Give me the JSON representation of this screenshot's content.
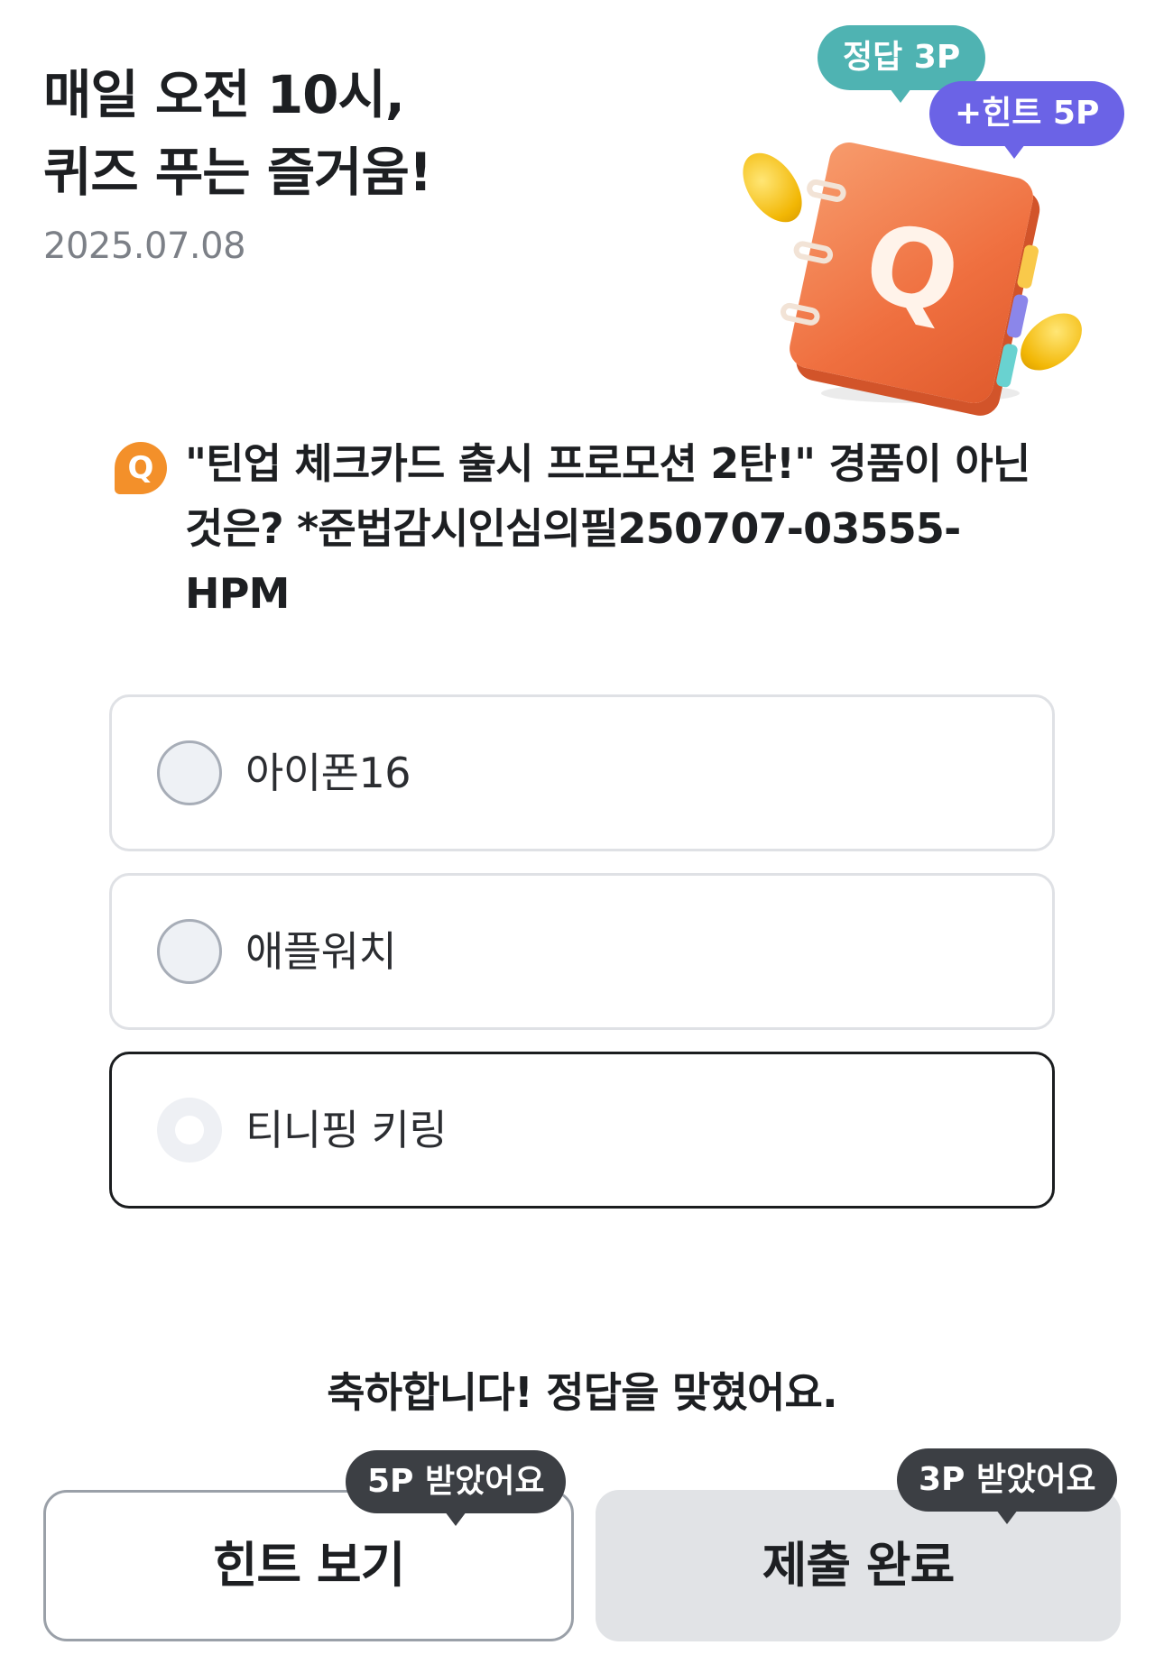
{
  "header": {
    "title_line1": "매일 오전 10시,",
    "title_line2": "퀴즈 푸는 즐거움!",
    "date": "2025.07.08"
  },
  "illustration": {
    "answer_bubble": "정답 3P",
    "hint_bubble": "+힌트 5P",
    "book_letter": "Q",
    "answer_bubble_color": "#4fb3b2",
    "hint_bubble_color": "#6b63e6",
    "icons": [
      "coin-icon",
      "quiz-book-icon"
    ]
  },
  "quiz": {
    "badge": "Q",
    "question": "\"틴업 체크카드 출시 프로모션 2탄!\" 경품이 아닌 것은? *준법감시인심의필250707-03555-HPM",
    "options": [
      {
        "label": "아이폰16",
        "selected": false
      },
      {
        "label": "애플워치",
        "selected": false
      },
      {
        "label": "티니핑 키링",
        "selected": true
      }
    ],
    "badge_color": "#f3902a"
  },
  "result": {
    "message": "축하합니다! 정답을 맞혔어요."
  },
  "actions": {
    "hint_button": "힌트 보기",
    "hint_tooltip": "5P 받았어요",
    "submit_button": "제출 완료",
    "submit_tooltip": "3P 받았어요"
  }
}
